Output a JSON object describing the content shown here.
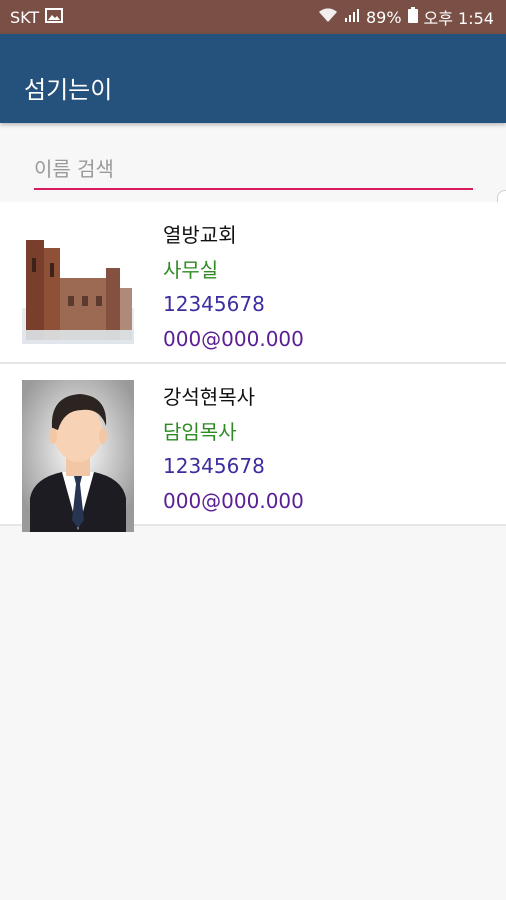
{
  "status": {
    "carrier": "SKT",
    "battery": "89%",
    "time": "오후 1:54"
  },
  "appbar": {
    "title": "섬기는이"
  },
  "search": {
    "placeholder": "이름 검색",
    "value": ""
  },
  "contacts": [
    {
      "name": "열방교회",
      "role": "사무실",
      "phone": "12345678",
      "email": "000@000.000",
      "photo": "church-photo"
    },
    {
      "name": "강석현목사",
      "role": "담임목사",
      "phone": "12345678",
      "email": "000@000.000",
      "photo": "person-avatar"
    }
  ],
  "colors": {
    "statusbar": "#7a5046",
    "appbar": "#25527d",
    "accent": "#d81b60",
    "role_text": "#2e8b23",
    "phone_text": "#3b2ea0",
    "email_text": "#5a1f95"
  }
}
